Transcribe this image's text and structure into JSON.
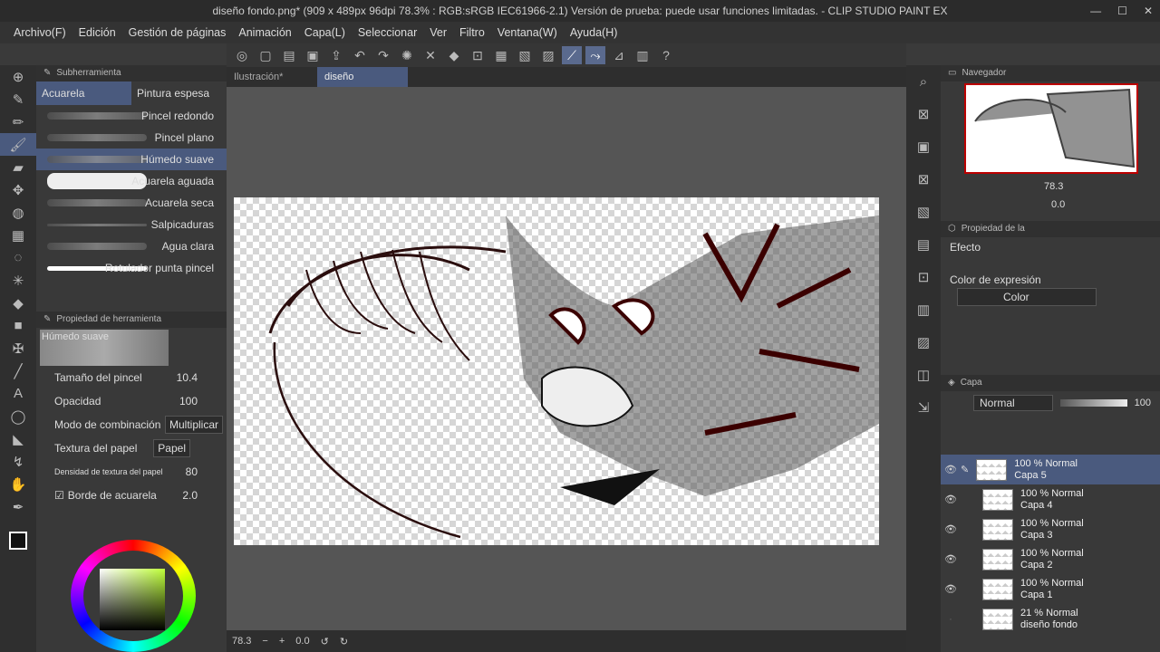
{
  "window": {
    "title": "diseño fondo.png* (909 x 489px 96dpi 78.3% : RGB:sRGB IEC61966-2.1)  Versión de prueba: puede usar funciones limitadas. - CLIP STUDIO PAINT EX",
    "min": "—",
    "max": "☐",
    "close": "✕"
  },
  "menu": [
    "Archivo(F)",
    "Edición",
    "Gestión de páginas",
    "Animación",
    "Capa(L)",
    "Seleccionar",
    "Ver",
    "Filtro",
    "Ventana(W)",
    "Ayuda(H)"
  ],
  "subtool": {
    "header": "Subherramienta",
    "tabs": [
      "Acuarela",
      "Pintura espesa"
    ],
    "brushes": [
      "Pincel redondo",
      "Pincel plano",
      "Húmedo suave",
      "Acuarela aguada",
      "Acuarela seca",
      "Salpicaduras",
      "Agua clara",
      "Rotulador punta pincel"
    ],
    "selected_brush": "Húmedo suave"
  },
  "toolprops": {
    "header": "Propiedad de herramienta",
    "preset": "Húmedo suave",
    "rows": [
      {
        "label": "Tamaño del pincel",
        "value": "10.4"
      },
      {
        "label": "Opacidad",
        "value": "100"
      },
      {
        "label": "Modo de combinación",
        "value": "Multiplicar"
      },
      {
        "label": "Textura del papel",
        "value": "Papel"
      },
      {
        "label": "Densidad de textura del papel",
        "value": "80"
      },
      {
        "label": "Borde de acuarela",
        "value": "2.0"
      }
    ]
  },
  "doc_tabs": [
    "Ilustración*",
    "diseño fondo.png*"
  ],
  "status": {
    "zoom": "78.3",
    "angle": "0.0"
  },
  "navigator": {
    "header": "Navegador",
    "zoom": "78.3",
    "angle": "0.0"
  },
  "layerprops": {
    "header": "Propiedad de la",
    "effect": "Efecto",
    "color_label": "Color de expresión",
    "color_value": "Color"
  },
  "layers": {
    "header": "Capa",
    "blend": "Normal",
    "opacity": "100",
    "items": [
      {
        "line1": "100 % Normal",
        "line2": "Capa 5"
      },
      {
        "line1": "100 % Normal",
        "line2": "Capa 4"
      },
      {
        "line1": "100 % Normal",
        "line2": "Capa 3"
      },
      {
        "line1": "100 % Normal",
        "line2": "Capa 2"
      },
      {
        "line1": "100 % Normal",
        "line2": "Capa 1"
      },
      {
        "line1": "21 % Normal",
        "line2": "diseño fondo"
      }
    ]
  }
}
